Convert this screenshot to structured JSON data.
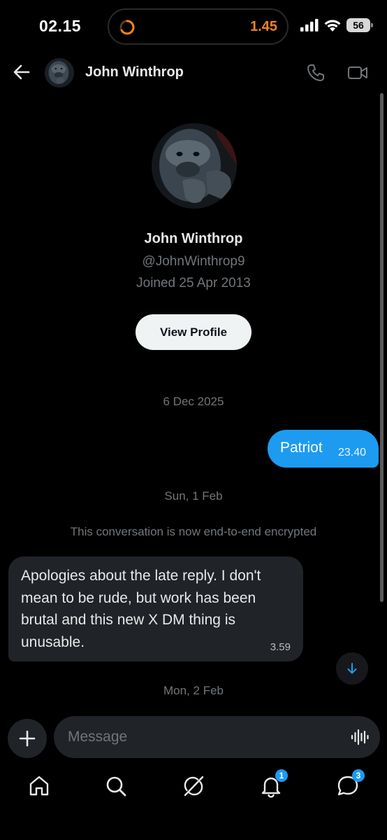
{
  "status_bar": {
    "time": "02.15",
    "island_value": "1.45",
    "battery": "56",
    "icons": [
      "signal-icon",
      "wifi-icon",
      "battery-icon"
    ],
    "island_accent": "#f5821f"
  },
  "header": {
    "name": "John Winthrop",
    "icons": [
      "back-arrow-icon",
      "phone-icon",
      "video-camera-icon"
    ]
  },
  "profile": {
    "name": "John Winthrop",
    "handle": "@JohnWinthrop9",
    "joined": "Joined 25 Apr 2013",
    "view_profile_label": "View Profile"
  },
  "conversation": {
    "date_1": "6 Dec 2025",
    "outgoing": {
      "text": "Patriot",
      "time": "23.40"
    },
    "date_2": "Sun, 1 Feb",
    "encryption_notice": "This conversation is now end-to-end encrypted",
    "incoming": {
      "text": "Apologies about the late reply. I don't mean to be rude, but work has been brutal and this new X DM thing is unusable.",
      "time": "3.59"
    },
    "date_3": "Mon, 2 Feb"
  },
  "composer": {
    "placeholder": "Message",
    "icons": [
      "plus-icon",
      "voice-waveform-icon"
    ]
  },
  "bottom_nav": {
    "items": [
      "home-icon",
      "search-icon",
      "grok-icon",
      "notifications-icon",
      "messages-icon"
    ],
    "notifications_badge": "1",
    "messages_badge": "3"
  },
  "colors": {
    "accent": "#1d9bf0",
    "background": "#000000",
    "bubble_in": "#202327",
    "muted_text": "#71767b"
  }
}
